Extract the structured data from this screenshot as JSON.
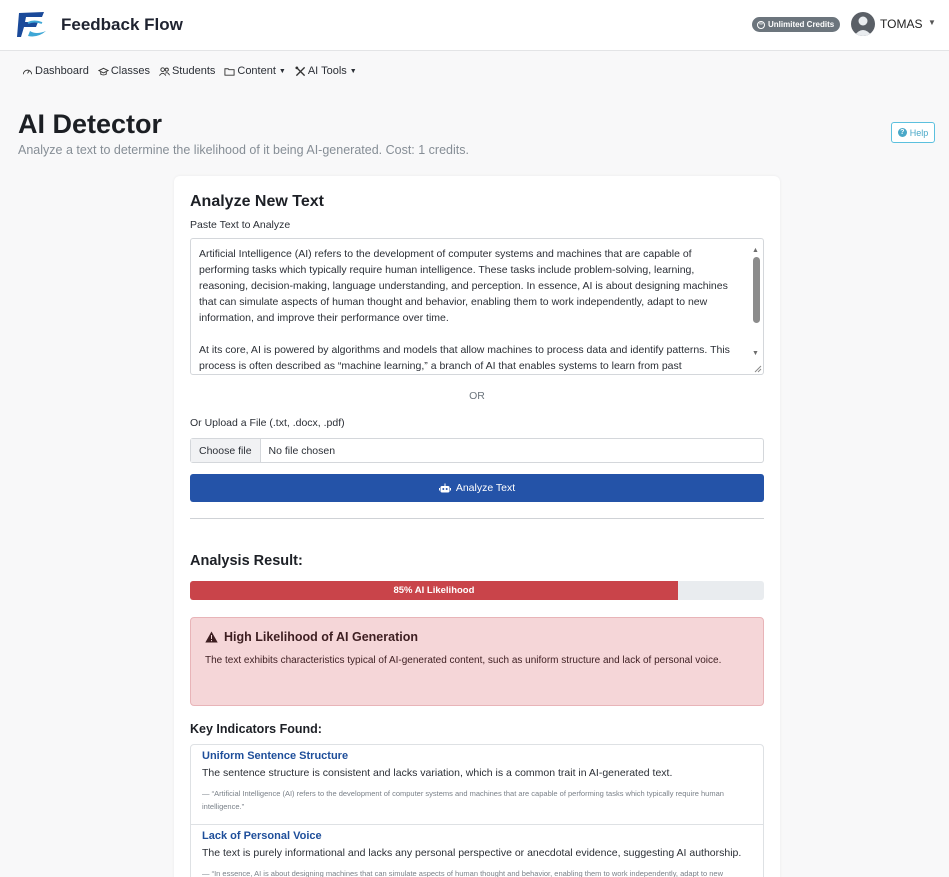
{
  "app": {
    "brand": "Feedback Flow",
    "credits_badge": "Unlimited Credits",
    "user_name": "TOMAS"
  },
  "nav": {
    "items": [
      {
        "label": "Dashboard",
        "icon": "gauge-icon",
        "dropdown": false
      },
      {
        "label": "Classes",
        "icon": "graduation-cap-icon",
        "dropdown": false
      },
      {
        "label": "Students",
        "icon": "people-icon",
        "dropdown": false
      },
      {
        "label": "Content",
        "icon": "folder-icon",
        "dropdown": true
      },
      {
        "label": "AI Tools",
        "icon": "tools-icon",
        "dropdown": true
      }
    ]
  },
  "page": {
    "title": "AI Detector",
    "subtitle": "Analyze a text to determine the likelihood of it being AI-generated. Cost: 1 credits.",
    "help_label": "Help"
  },
  "form": {
    "title": "Analyze New Text",
    "text_label": "Paste Text to Analyze",
    "text_paragraphs": [
      "Artificial Intelligence (AI) refers to the development of computer systems and machines that are capable of performing tasks which typically require human intelligence. These tasks include problem-solving, learning, reasoning, decision-making, language understanding, and perception. In essence, AI is about designing machines that can simulate aspects of human thought and behavior, enabling them to work independently, adapt to new information, and improve their performance over time.",
      "At its core, AI is powered by algorithms and models that allow machines to process data and identify patterns. This process is often described as “machine learning,” a branch of AI that enables systems to learn from past"
    ],
    "or_label": "OR",
    "upload_label": "Or Upload a File (.txt, .docx, .pdf)",
    "choose_file_label": "Choose file",
    "no_file_label": "No file chosen",
    "analyze_label": "Analyze Text"
  },
  "result": {
    "title": "Analysis Result:",
    "likelihood_percent": 85,
    "progress_label": "85% AI Likelihood",
    "alert_title": "High Likelihood of AI Generation",
    "alert_body": "The text exhibits characteristics typical of AI-generated content, such as uniform structure and lack of personal voice.",
    "indicators_title": "Key Indicators Found:",
    "indicators": [
      {
        "name": "Uniform Sentence Structure",
        "description": "The sentence structure is consistent and lacks variation, which is a common trait in AI-generated text.",
        "quote": "— “Artificial Intelligence (AI) refers to the development of computer systems and machines that are capable of performing tasks which typically require human intelligence.”"
      },
      {
        "name": "Lack of Personal Voice",
        "description": "The text is purely informational and lacks any personal perspective or anecdotal evidence, suggesting AI authorship.",
        "quote": "— “In essence, AI is about designing machines that can simulate aspects of human thought and behavior, enabling them to work independently, adapt to new information, and improve their performance over time.”"
      }
    ]
  },
  "colors": {
    "primary_button": "#2453a8",
    "danger": "#c9444a",
    "alert_bg": "#f5d6d8",
    "link": "#1e4e9a"
  }
}
